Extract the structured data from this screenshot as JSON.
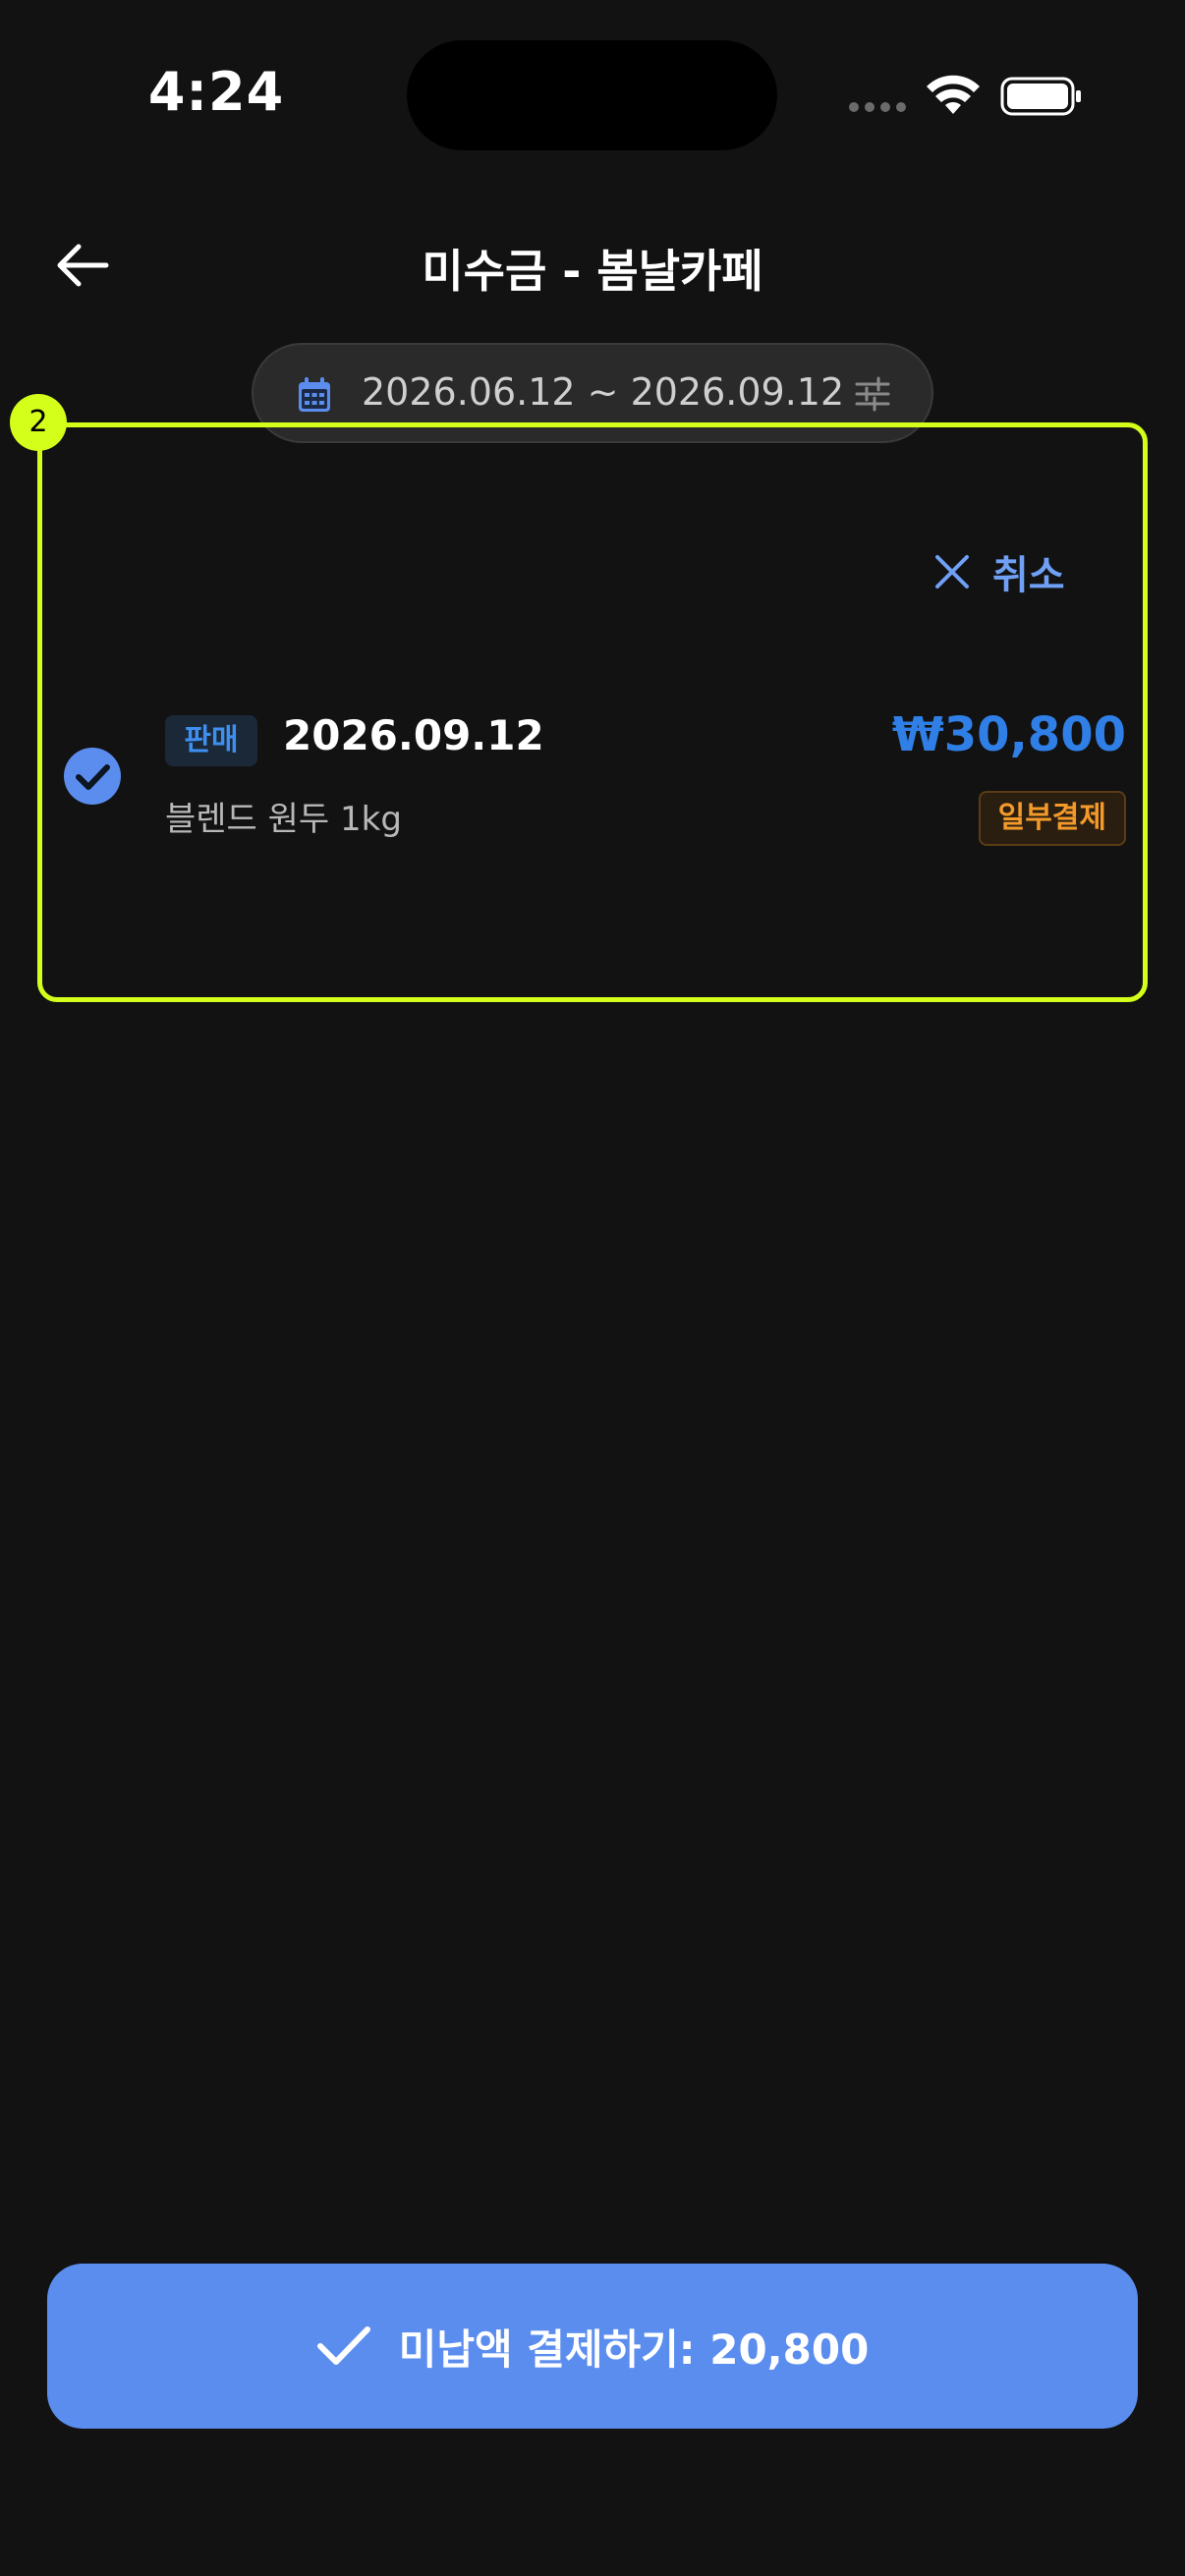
{
  "status_bar": {
    "time": "4:24"
  },
  "header": {
    "title": "미수금 - 봄날카페",
    "back_icon": "arrow-left-icon"
  },
  "date_filter": {
    "range": "2026.06.12 ~ 2026.09.12",
    "calendar_icon": "calendar-icon",
    "filter_icon": "sliders-icon"
  },
  "highlight": {
    "badge": "2",
    "color": "#d4ff1a"
  },
  "selection": {
    "cancel_label": "취소",
    "cancel_icon": "close-icon"
  },
  "transactions": [
    {
      "selected": true,
      "type": "판매",
      "date": "2026.09.12",
      "description": "블렌드 원두 1kg",
      "amount": "₩30,800",
      "status": "일부결제"
    }
  ],
  "pay_button": {
    "label": "미납액 결제하기: 20,800",
    "icon": "check-icon"
  },
  "colors": {
    "background": "#121212",
    "accent": "#5b8def",
    "amount": "#2f7fe6",
    "partial_status": "#f39a2b"
  }
}
